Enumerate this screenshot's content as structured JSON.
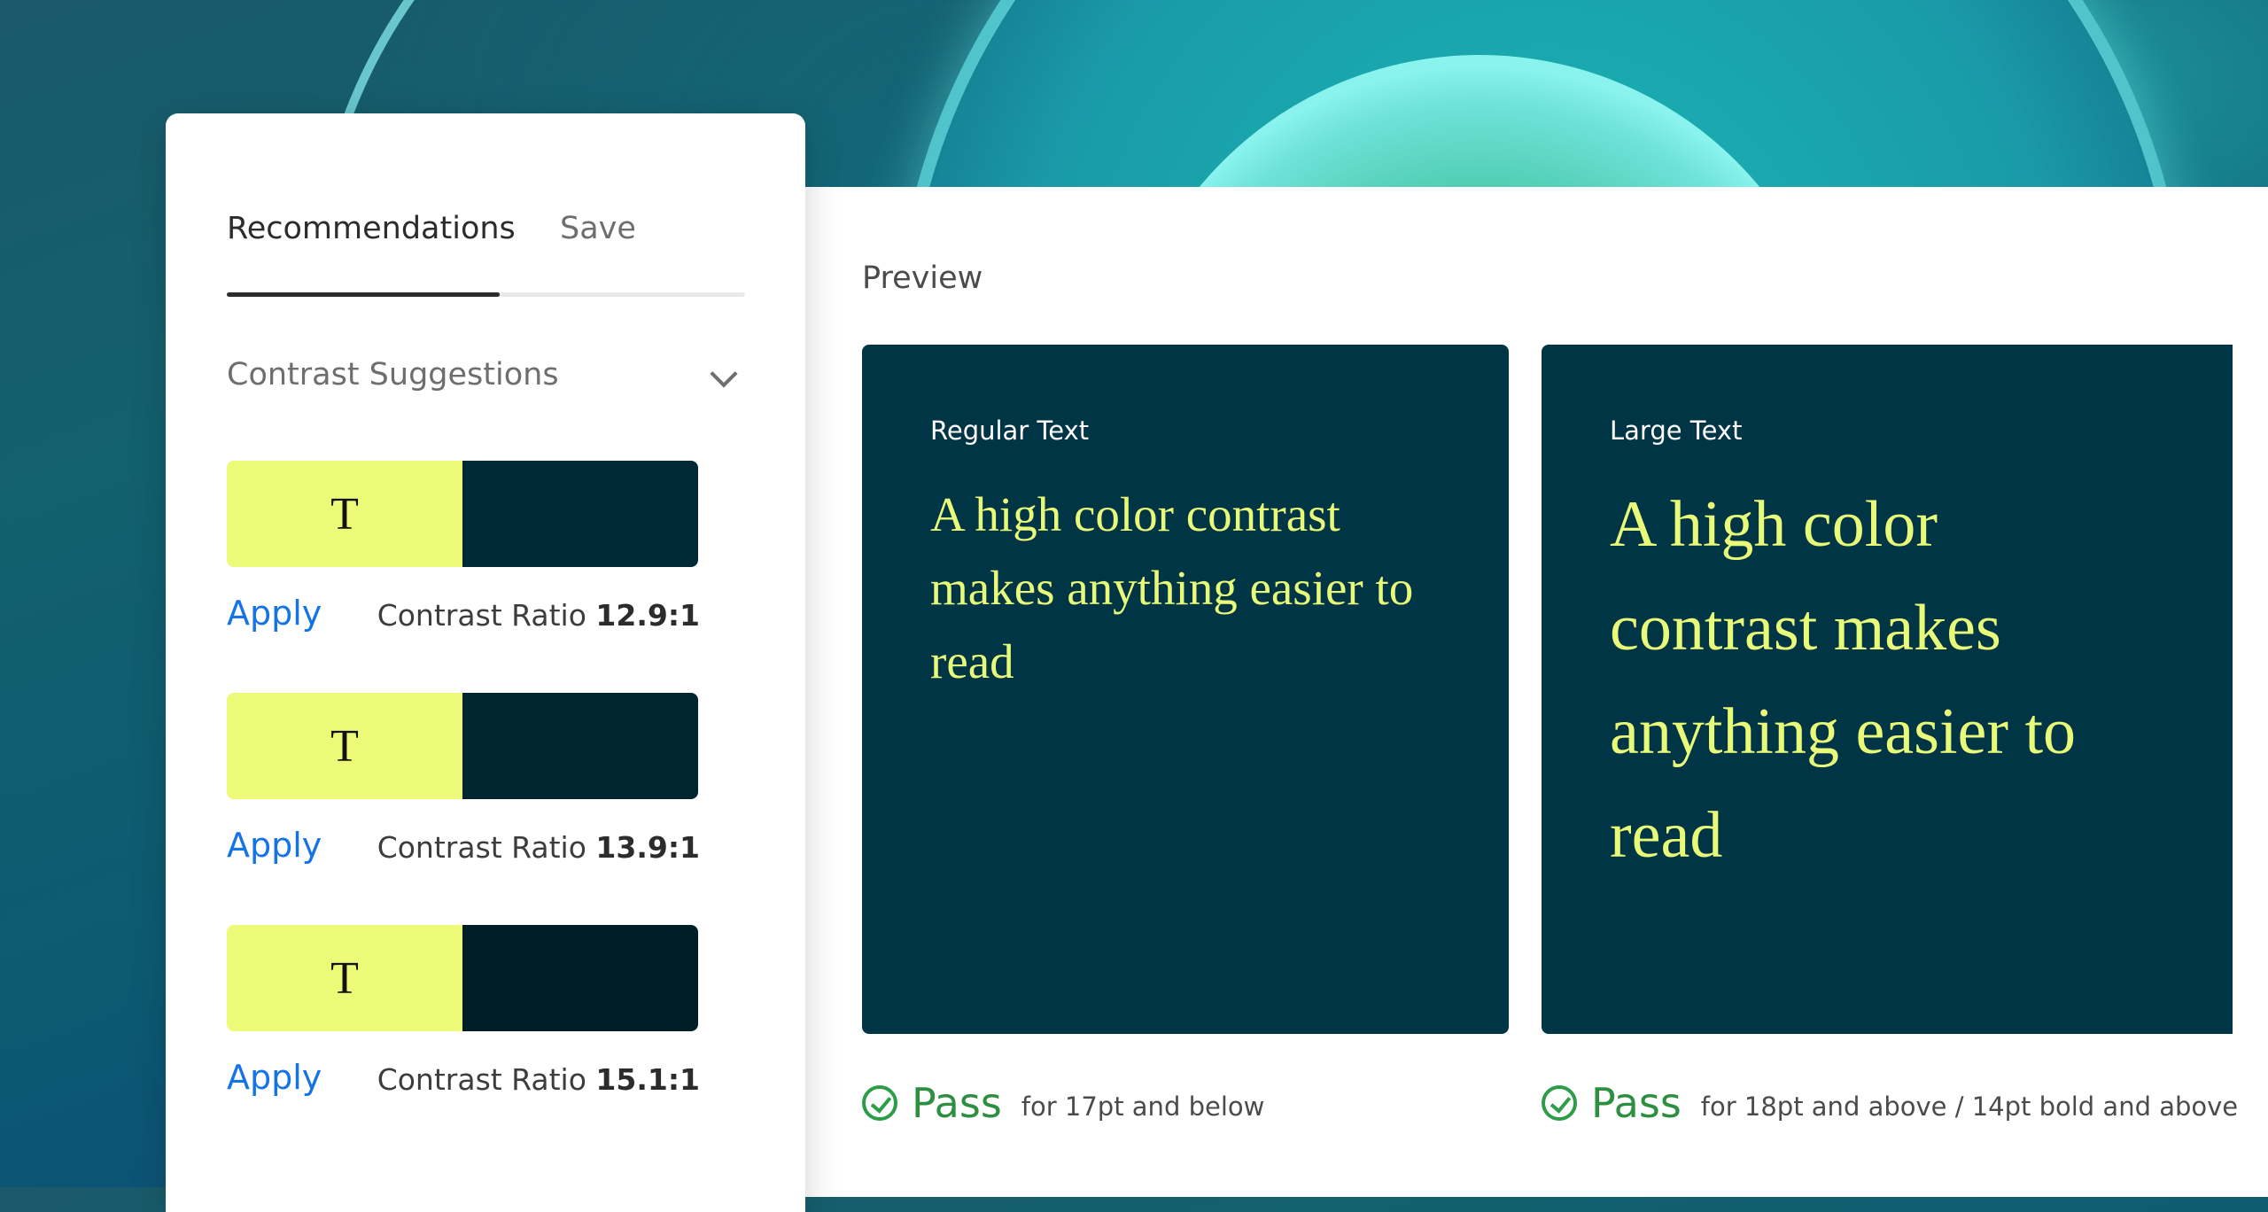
{
  "tabs": {
    "recommendations": "Recommendations",
    "save": "Save"
  },
  "contrast_section": {
    "title": "Contrast Suggestions",
    "suggestions": [
      {
        "swatch_letter": "T",
        "fg_color": "#ECFA78",
        "bg_color": "#002936",
        "apply_label": "Apply",
        "ratio_label": "Contrast Ratio",
        "ratio_value": "12.9:1"
      },
      {
        "swatch_letter": "T",
        "fg_color": "#ECFA78",
        "bg_color": "#002430",
        "apply_label": "Apply",
        "ratio_label": "Contrast Ratio",
        "ratio_value": "13.9:1"
      },
      {
        "swatch_letter": "T",
        "fg_color": "#ECFA78",
        "bg_color": "#001E26",
        "apply_label": "Apply",
        "ratio_label": "Contrast Ratio",
        "ratio_value": "15.1:1"
      }
    ]
  },
  "preview": {
    "title": "Preview",
    "regular": {
      "label": "Regular Text",
      "sample": "A high color contrast makes anything easier to read",
      "pass_word": "Pass",
      "pass_desc": "for 17pt and below"
    },
    "large": {
      "label": "Large Text",
      "sample": "A high color contrast makes anything easier to read",
      "pass_word": "Pass",
      "pass_desc": "for 18pt and above / 14pt bold and above"
    },
    "card_background": "#003545",
    "text_color": "#E8FA78",
    "pass_color": "#2D8F3F"
  },
  "icons": {
    "chevron": "chevron-down-icon",
    "check": "check-circle-icon"
  },
  "colors": {
    "link": "#1473E6"
  }
}
